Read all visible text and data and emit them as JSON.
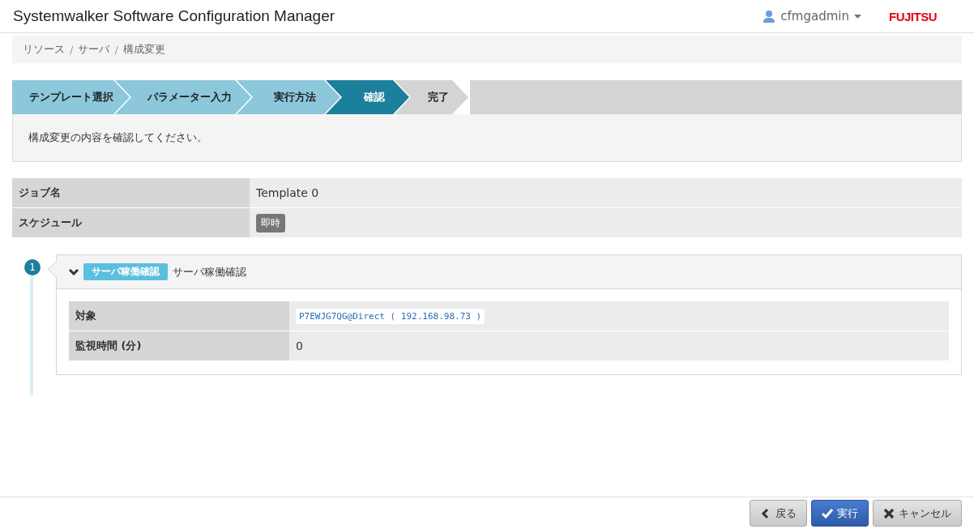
{
  "header": {
    "title": "Systemwalker Software Configuration Manager",
    "user": "cfmgadmin",
    "logo": "FUJITSU"
  },
  "breadcrumb": [
    "リソース",
    "サーバ",
    "構成変更"
  ],
  "breadcrumb_separator": "/",
  "steps": [
    {
      "label": "テンプレート選択",
      "completed": true,
      "selected": false
    },
    {
      "label": "パラメーター入力",
      "completed": true,
      "selected": false
    },
    {
      "label": "実行方法",
      "completed": true,
      "selected": false
    },
    {
      "label": "確認",
      "completed": false,
      "selected": true
    },
    {
      "label": "完了",
      "completed": false,
      "selected": false
    }
  ],
  "message": "構成変更の内容を確認してください。",
  "job": [
    {
      "label": "ジョブ名",
      "value": "Template 0",
      "kind": "text"
    },
    {
      "label": "スケジュール",
      "value": "即時",
      "kind": "badge"
    }
  ],
  "tasks": [
    {
      "number": "1",
      "expanded": true,
      "tag": "サーバ稼働確認",
      "title": "サーバ稼働確認",
      "params": [
        {
          "label": "対象",
          "value": "P7EWJG7QG@Direct ( 192.168.98.73 )",
          "kind": "code"
        },
        {
          "label": "監視時間 (分)",
          "value": "0",
          "kind": "text"
        }
      ]
    }
  ],
  "buttons": [
    {
      "label": "戻る",
      "kind": "back"
    },
    {
      "label": "実行",
      "kind": "run"
    },
    {
      "label": "キャンセル",
      "kind": "cancel"
    }
  ]
}
